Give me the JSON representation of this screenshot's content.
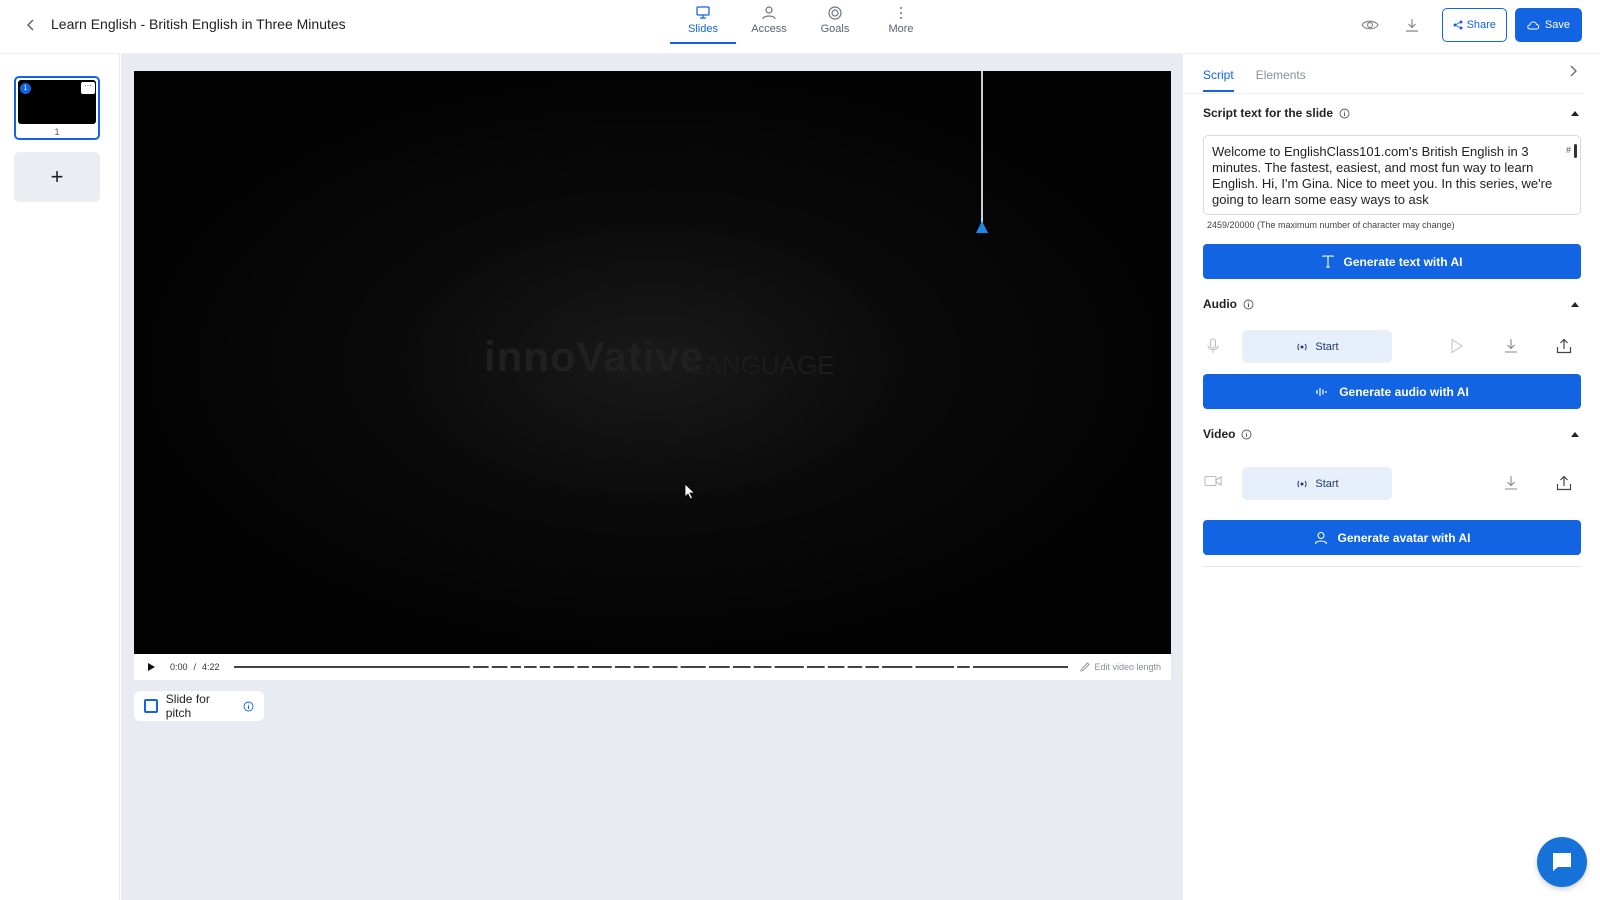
{
  "header": {
    "title": "Learn English - British English in Three Minutes",
    "nav": [
      {
        "label": "Slides",
        "icon": "presentation-icon",
        "active": true
      },
      {
        "label": "Access",
        "icon": "user-icon",
        "active": false
      },
      {
        "label": "Goals",
        "icon": "target-icon",
        "active": false
      },
      {
        "label": "More",
        "icon": "more-vertical-icon",
        "active": false
      }
    ],
    "share_label": "Share",
    "save_label": "Save"
  },
  "slides": {
    "items": [
      {
        "number": "1",
        "badge": "1"
      }
    ],
    "add_label": "+"
  },
  "video": {
    "logo_primary": "innoVative",
    "logo_secondary": "LANGUAGE",
    "current_time": "0:00",
    "separator": "/",
    "duration": "4:22",
    "edit_length_label": "Edit video length"
  },
  "pitch": {
    "label": "Slide for pitch",
    "checked": false
  },
  "panel": {
    "tabs": [
      {
        "label": "Script",
        "active": true
      },
      {
        "label": "Elements",
        "active": false
      }
    ],
    "script": {
      "title": "Script text for the slide",
      "text": "Welcome to EnglishClass101.com's British English in 3 minutes. The fastest, easiest, and most fun way to learn English. Hi, I'm Gina. Nice to meet you. In this series, we're going to learn some easy ways to ask",
      "hash": "#",
      "char_count": "2459/20000 (The maximum number of character may change)",
      "ai_label": "Generate text with AI"
    },
    "audio": {
      "title": "Audio",
      "start_label": "Start",
      "ai_label": "Generate audio with AI"
    },
    "video": {
      "title": "Video",
      "start_label": "Start",
      "ai_label": "Generate avatar with AI"
    }
  },
  "colors": {
    "accent": "#1264e2",
    "workspace_bg": "#e8ebf2",
    "start_bg": "#e7effb"
  }
}
